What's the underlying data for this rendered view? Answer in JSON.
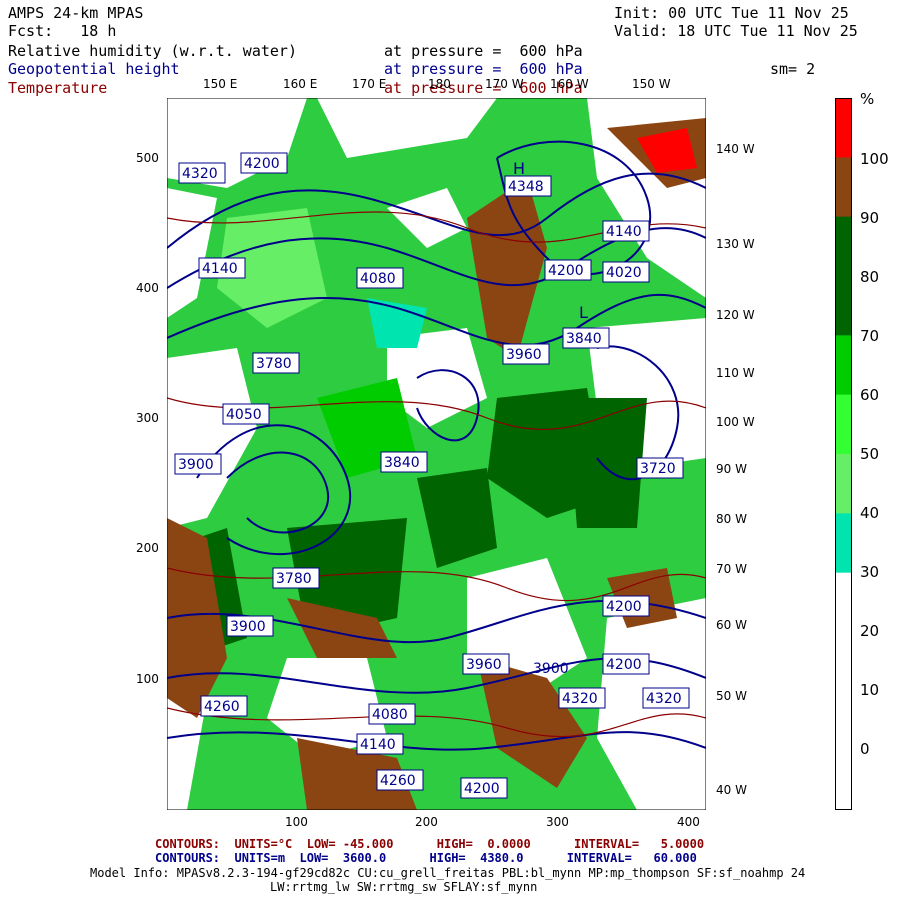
{
  "header": {
    "line1_left": "AMPS 24-km MPAS",
    "line1_right": "Init: 00 UTC Tue 11 Nov 25",
    "line2_left": "Fcst:   18 h",
    "line2_right": "Valid: 18 UTC Tue 11 Nov 25",
    "fields": [
      {
        "name": "Relative humidity (w.r.t. water)",
        "level": "at pressure =  600 hPa",
        "color": "#000000"
      },
      {
        "name": "Geopotential height",
        "level": "at pressure =  600 hPa",
        "color": "#00008b"
      },
      {
        "name": "Temperature",
        "level": "at pressure =  600 hPa",
        "color": "#8b0000"
      }
    ],
    "smoothing": "sm= 2"
  },
  "map": {
    "x_ticks": [
      "100",
      "200",
      "300",
      "400"
    ],
    "y_ticks": [
      "500",
      "400",
      "300",
      "200",
      "100"
    ],
    "lon_top": [
      "150 E",
      "160 E",
      "170 E",
      "180",
      "170 W",
      "160 W",
      "150 W"
    ],
    "lon_right": [
      "140 W",
      "130 W",
      "120 W",
      "110 W",
      "100 W",
      "90 W",
      "80 W",
      "70 W",
      "60 W",
      "50 W",
      "40 W"
    ],
    "height_labels": [
      "4320",
      "4200",
      "4348",
      "4140",
      "4020",
      "4200",
      "4140",
      "4080",
      "3780",
      "3960",
      "3840",
      "4050",
      "3900",
      "3840",
      "3720",
      "3780",
      "3900",
      "4080",
      "4260",
      "4140",
      "4200",
      "4320",
      "4260",
      "4200",
      "3900",
      "3960",
      "4200",
      "4320"
    ],
    "pressure_centers": [
      {
        "label": "H",
        "value": "4348"
      },
      {
        "label": "L",
        "value": "3840"
      }
    ]
  },
  "colorbar": {
    "unit": "%",
    "ticks": [
      "100",
      "90",
      "80",
      "70",
      "60",
      "50",
      "40",
      "30",
      "20",
      "10",
      "0"
    ],
    "colors": [
      "#ff0000",
      "#8b4513",
      "#006400",
      "#006400",
      "#00cc00",
      "#33ff33",
      "#66ee66",
      "#00e5b0",
      "#ffffff",
      "#ffffff",
      "#ffffff"
    ]
  },
  "footer": {
    "temp_contours": "CONTOURS:  UNITS=°C  LOW= -45.000      HIGH=  0.0000      INTERVAL=   5.0000",
    "height_contours": "CONTOURS:  UNITS=m  LOW=  3600.0      HIGH=  4380.0      INTERVAL=   60.000",
    "model_info": "Model Info: MPASv8.2.3-194-gf29cd82c CU:cu_grell_freitas PBL:bl_mynn MP:mp_thompson SF:sf_noahmp 24",
    "model_info2": "LW:rrtmg_lw SW:rrtmg_sw SFLAY:sf_mynn"
  }
}
